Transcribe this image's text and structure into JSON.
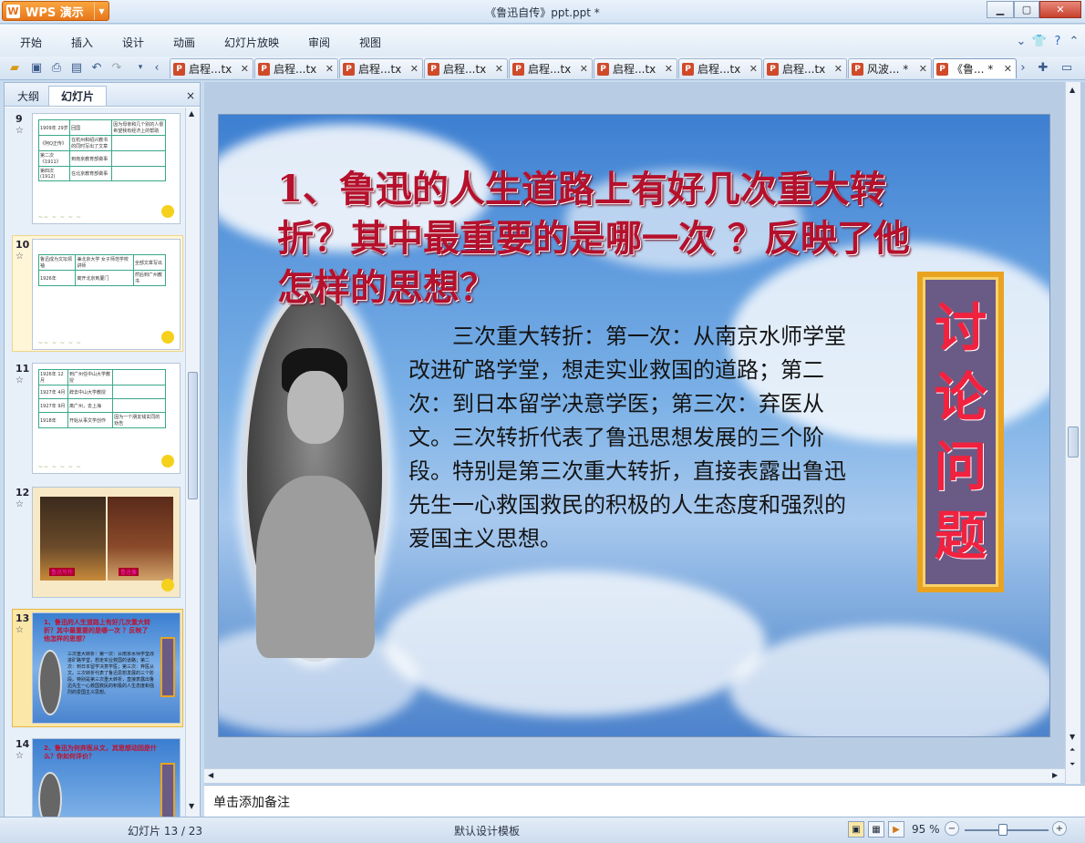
{
  "app": {
    "name": "WPS 演示",
    "document_title": "《鲁迅自传》ppt.ppt *"
  },
  "menu": [
    "开始",
    "插入",
    "设计",
    "动画",
    "幻灯片放映",
    "审阅",
    "视图"
  ],
  "doc_tabs": [
    {
      "label": "启程...tx",
      "active": false
    },
    {
      "label": "启程...tx",
      "active": false
    },
    {
      "label": "启程...tx",
      "active": false
    },
    {
      "label": "启程...tx",
      "active": false
    },
    {
      "label": "启程...tx",
      "active": false
    },
    {
      "label": "启程...tx",
      "active": false
    },
    {
      "label": "启程...tx",
      "active": false
    },
    {
      "label": "启程...tx",
      "active": false
    },
    {
      "label": "风波... *",
      "active": false
    },
    {
      "label": "《鲁... *",
      "active": true
    }
  ],
  "left_pane": {
    "tabs": [
      "大纲",
      "幻灯片"
    ],
    "active_tab": "幻灯片",
    "close": "×",
    "thumbnails": [
      {
        "num": "9",
        "rows": [
          [
            "1909年 29岁",
            "回国",
            "因为母亲和几个别的人很希望我有经济上的帮助"
          ],
          [
            "《阿Q正传》",
            "在杭州和绍兴教书的同时写出了文章",
            ""
          ],
          [
            "第二次 《1911》",
            "到南京教育部做事",
            ""
          ],
          [
            "第四次(1912)",
            "在北京教育部做事",
            ""
          ]
        ]
      },
      {
        "num": "10",
        "rows": [
          [
            "鲁迅成为文坛领袖",
            "兼北京大学 女子师范学校讲师",
            "全部文章写出"
          ],
          [
            "1926年",
            "离开北京到厦门",
            "然后到广州教书"
          ]
        ]
      },
      {
        "num": "11",
        "rows": [
          [
            "1926年 12月",
            "到广州任中山大学教授",
            ""
          ],
          [
            "1927年 4月",
            "辞去中山大学教授",
            ""
          ],
          [
            "1927年 9月",
            "离广州，去上海",
            ""
          ],
          [
            "1918年",
            "开始从事文学创作",
            "因为一个朋友钱玄同的劝告"
          ]
        ]
      },
      {
        "num": "12",
        "captions": [
          "鲁迅写作",
          "鲁迅像"
        ]
      },
      {
        "num": "13",
        "selected": true
      },
      {
        "num": "14",
        "title": "2、鲁迅为何弃医从文，其思想动因是什么？你如何评价？"
      }
    ]
  },
  "slide": {
    "title": "1、鲁迅的人生道路上有好几次重大转折？其中最重要的是哪一次 ？反映了他怎样的思想？",
    "body": "三次重大转折：第一次：从南京水师学堂改进矿路学堂，想走实业救国的道路；第二次：到日本留学决意学医；第三次：弃医从文。三次转折代表了鲁迅思想发展的三个阶段。特别是第三次重大转折，直接表露出鲁迅先生一心救国救民的积极的人生态度和强烈的爱国主义思想。",
    "side_label": [
      "讨",
      "论",
      "问",
      "题"
    ],
    "colors": {
      "title": "#b5102c",
      "side_text": "#f1223f",
      "side_bg": "#6a5a86",
      "side_border": "#e9a321"
    }
  },
  "notes": {
    "placeholder": "单击添加备注"
  },
  "status": {
    "slide_info": "幻灯片 13 / 23",
    "template": "默认设计模板",
    "zoom": "95 %"
  }
}
